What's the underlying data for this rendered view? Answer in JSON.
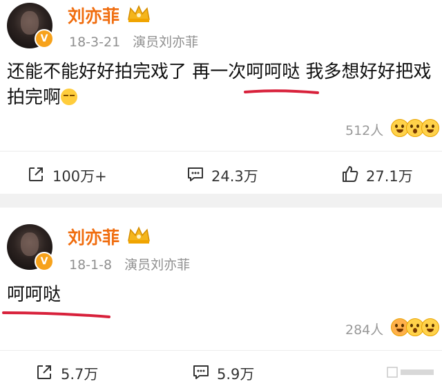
{
  "posts": [
    {
      "author": "刘亦菲",
      "date": "18-3-21",
      "source": "演员刘亦菲",
      "text_line1": "还能不能好好拍完戏了 再一次呵呵哒 我多想好好把戏",
      "text_line2": "拍完啊",
      "likes_count": "512人",
      "repost": "100万+",
      "comment": "24.3万",
      "like": "27.1万"
    },
    {
      "author": "刘亦菲",
      "date": "18-1-8",
      "source": "演员刘亦菲",
      "text_line1": "呵呵哒",
      "likes_count": "284人",
      "repost": "5.7万",
      "comment": "5.9万"
    }
  ],
  "colors": {
    "name": "#f06d0f",
    "meta": "#8f8f8f",
    "underline": "#d8213b",
    "badge": "#f7a21b"
  },
  "icons": [
    "verified-badge-icon",
    "crown-icon",
    "repost-icon",
    "comment-icon",
    "like-icon",
    "reaction-face-icon"
  ]
}
